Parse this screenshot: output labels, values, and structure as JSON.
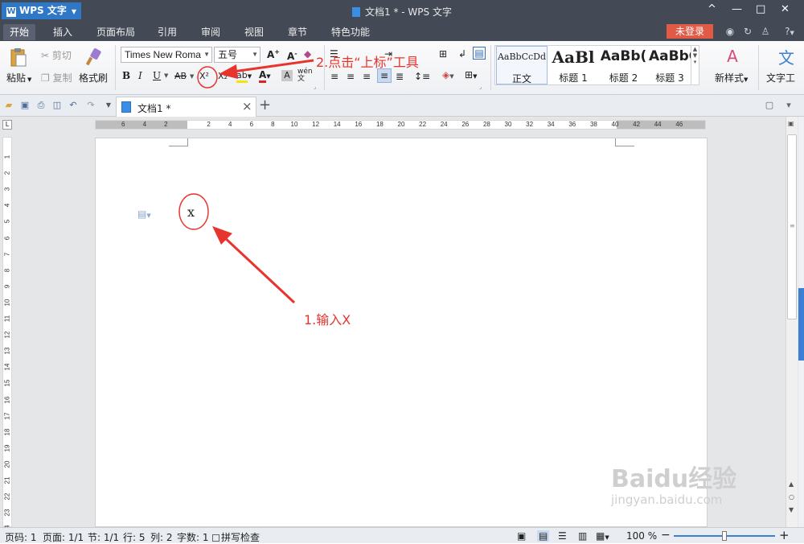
{
  "titlebar": {
    "app_name": "WPS 文字",
    "doc_title": "文档1 * - WPS 文字",
    "controls": [
      "^",
      "—",
      "□",
      "✕"
    ]
  },
  "menu": {
    "tabs": [
      "开始",
      "插入",
      "页面布局",
      "引用",
      "审阅",
      "视图",
      "章节",
      "特色功能"
    ],
    "active": "开始",
    "login": "未登录",
    "help": "?"
  },
  "ribbon": {
    "paste": "粘贴",
    "cut": "剪切",
    "copy": "复制",
    "format_painter": "格式刷",
    "font_name": "Times New Roma",
    "font_size": "五号",
    "bold": "B",
    "italic": "I",
    "underline": "U",
    "strike": "AB",
    "superscript": "X²",
    "subscript": "X₂",
    "styles": [
      {
        "sample": "AaBbCcDd",
        "label": "正文"
      },
      {
        "sample": "AaBl",
        "label": "标题 1"
      },
      {
        "sample": "AaBb(",
        "label": "标题 2"
      },
      {
        "sample": "AaBbC",
        "label": "标题 3"
      }
    ],
    "new_style": "新样式",
    "text_tools": "文字工"
  },
  "tab": {
    "doc_name": "文档1 *",
    "close": "×",
    "add": "+"
  },
  "ruler": {
    "h_ticks": [
      "6",
      "4",
      "2",
      "2",
      "4",
      "6",
      "8",
      "10",
      "12",
      "14",
      "16",
      "18",
      "20",
      "22",
      "24",
      "26",
      "28",
      "30",
      "32",
      "34",
      "36",
      "38",
      "40",
      "42",
      "44",
      "46"
    ],
    "v_ticks": [
      "1",
      "2",
      "3",
      "4",
      "5",
      "6",
      "7",
      "8",
      "9",
      "10",
      "11",
      "12",
      "13",
      "14",
      "15",
      "16",
      "17",
      "18",
      "19",
      "20",
      "21",
      "22",
      "23",
      "24"
    ]
  },
  "document": {
    "text": "x"
  },
  "annotations": {
    "step1": "1.输入X",
    "step2": "2.点击“上标”工具",
    "color": "#e8342e"
  },
  "status": {
    "page_no": "页码: 1",
    "pages": "页面: 1/1",
    "section": "节: 1/1",
    "row": "行: 5",
    "col": "列: 2",
    "word_count": "字数: 1",
    "spell_check": "拼写检查",
    "zoom": "100 %",
    "zoom_fraction": 0.5
  },
  "watermark": {
    "brand": "Baidu经验",
    "url": "jingyan.baidu.com"
  },
  "colors": {
    "titlebar": "#434a55",
    "accent": "#2f78c8",
    "login": "#e05a45"
  }
}
